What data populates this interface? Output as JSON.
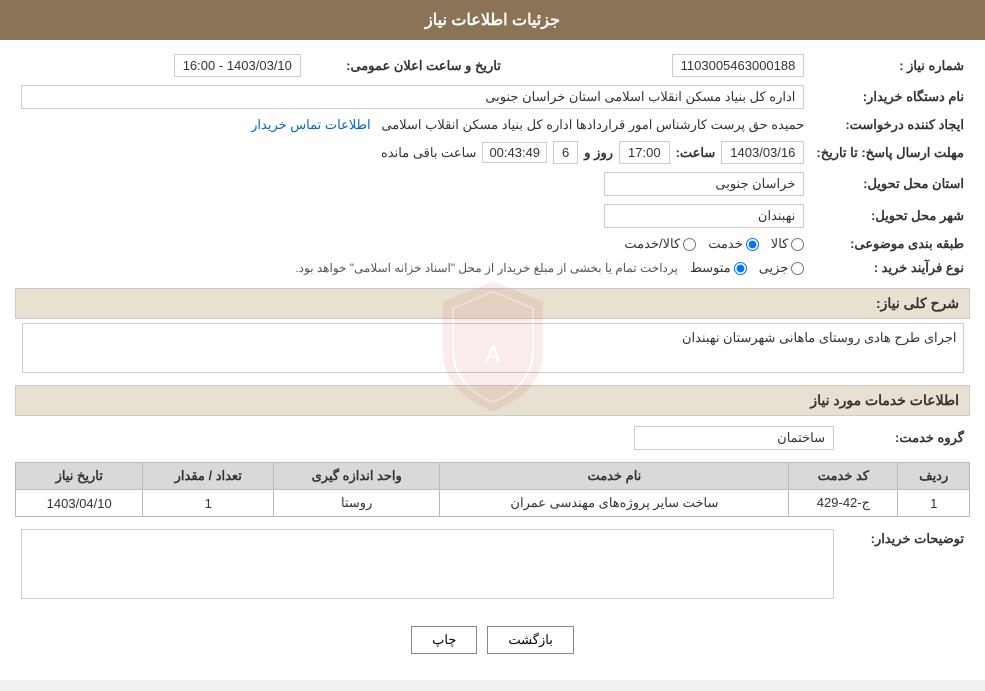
{
  "header": {
    "title": "جزئیات اطلاعات نیاز"
  },
  "fields": {
    "shomara_niaz_label": "شماره نیاز :",
    "shomara_niaz_value": "1103005463000188",
    "nam_dastgah_label": "نام دستگاه خریدار:",
    "nam_dastgah_value": "اداره کل بنیاد مسکن انقلاب اسلامی استان خراسان جنوبی",
    "ijad_label": "ایجاد کننده درخواست:",
    "ijad_value": "حمیده حق پرست کارشناس امور قراردادها اداره کل بنیاد مسکن انقلاب اسلامی",
    "etelaaat_link": "اطلاعات تماس خریدار",
    "mohlat_label": "مهلت ارسال پاسخ: تا تاریخ:",
    "mohlat_date": "1403/03/16",
    "mohlat_saat_label": "ساعت:",
    "mohlat_saat": "17:00",
    "mohlat_rooz_label": "روز و",
    "mohlat_rooz": "6",
    "countdown_label": "ساعت باقی مانده",
    "countdown_value": "00:43:49",
    "tarikh_label": "تاریخ و ساعت اعلان عمومی:",
    "tarikh_value": "1403/03/10 - 16:00",
    "ostan_label": "استان محل تحویل:",
    "ostan_value": "خراسان جنوبی",
    "shahr_label": "شهر محل تحویل:",
    "shahr_value": "نهبندان",
    "tabaghe_label": "طبقه بندی موضوعی:",
    "tabaghe_options": [
      "کالا",
      "خدمت",
      "کالا/خدمت"
    ],
    "tabaghe_selected": "خدمت",
    "nooe_label": "نوع فرآیند خرید :",
    "nooe_options": [
      "جزیی",
      "متوسط"
    ],
    "nooe_selected": "متوسط",
    "nooe_description": "پرداخت تمام یا بخشی از مبلغ خریدار از محل \"اسناد خزانه اسلامی\" خواهد بود.",
    "sharh_label": "شرح کلی نیاز:",
    "sharh_value": "اجرای طرح هادی روستای ماهانی  شهرستان نهبندان",
    "khadamat_header": "اطلاعات خدمات مورد نیاز",
    "grooh_label": "گروه خدمت:",
    "grooh_value": "ساختمان",
    "table": {
      "headers": [
        "ردیف",
        "کد خدمت",
        "نام خدمت",
        "واحد اندازه گیری",
        "تعداد / مقدار",
        "تاریخ نیاز"
      ],
      "rows": [
        {
          "radif": "1",
          "kod": "ج-42-429",
          "name": "ساخت سایر پروژه‌های مهندسی عمران",
          "vahed": "روستا",
          "tedad": "1",
          "tarikh": "1403/04/10"
        }
      ]
    },
    "tozihat_label": "توضیحات خریدار:",
    "tozihat_value": ""
  },
  "buttons": {
    "print_label": "چاپ",
    "back_label": "بازگشت"
  }
}
